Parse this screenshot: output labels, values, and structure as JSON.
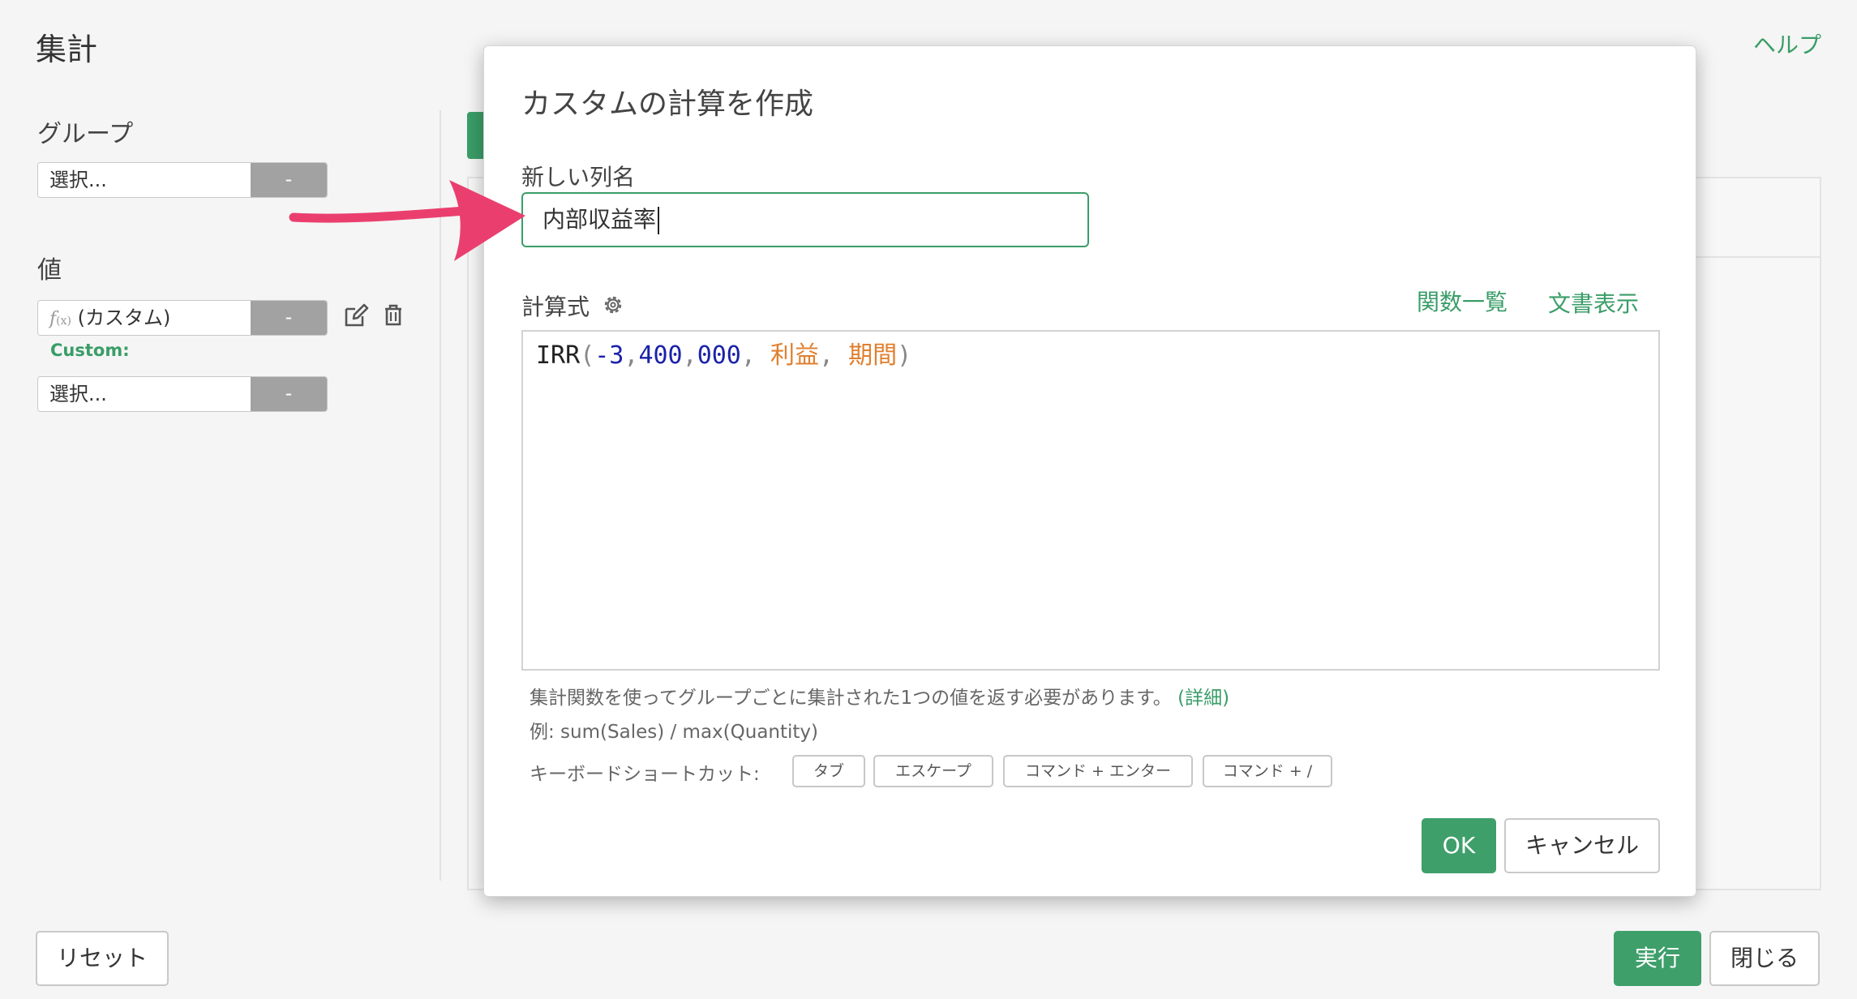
{
  "page": {
    "title": "集計",
    "help_link": "ヘルプ",
    "group_heading": "グループ",
    "group_select_placeholder": "選択...",
    "group_select_button": "-",
    "value_heading": "値",
    "value_custom_select": "(カスタム)",
    "value_custom_button": "-",
    "custom_label": "Custom:",
    "value_select_placeholder": "選択...",
    "value_select_button": "-",
    "reset_button": "リセット",
    "run_button": "実行",
    "close_button": "閉じる",
    "icons": [
      "fx-icon",
      "edit-icon",
      "trash-icon"
    ]
  },
  "modal": {
    "title": "カスタムの計算を作成",
    "new_column_label": "新しい列名",
    "new_column_value": "内部収益率",
    "formula_label": "計算式",
    "function_list_link": "関数一覧",
    "docs_link": "文書表示",
    "formula_tokens": [
      {
        "text": "IRR",
        "kind": "fn"
      },
      {
        "text": "(",
        "kind": "punc"
      },
      {
        "text": "-3",
        "kind": "num"
      },
      {
        "text": ",",
        "kind": "punc"
      },
      {
        "text": "400",
        "kind": "num"
      },
      {
        "text": ",",
        "kind": "punc"
      },
      {
        "text": "000",
        "kind": "num"
      },
      {
        "text": ", ",
        "kind": "punc"
      },
      {
        "text": "利益",
        "kind": "col"
      },
      {
        "text": ", ",
        "kind": "punc"
      },
      {
        "text": "期間",
        "kind": "col"
      },
      {
        "text": ")",
        "kind": "punc"
      }
    ],
    "hint_text": "集計関数を使ってグループごとに集計された1つの値を返す必要があります。",
    "hint_link": "(詳細)",
    "example_text": "例: sum(Sales) / max(Quantity)",
    "shortcuts_label": "キーボードショートカット:",
    "shortcuts": [
      "タブ",
      "エスケープ",
      "コマンド + エンター",
      "コマンド + /"
    ],
    "ok_button": "OK",
    "cancel_button": "キャンセル"
  },
  "colors": {
    "accent_green": "#3a9d68",
    "arrow_pink": "#ea3f6e",
    "token_number": "#1a22a8",
    "token_column": "#e07f2e"
  }
}
